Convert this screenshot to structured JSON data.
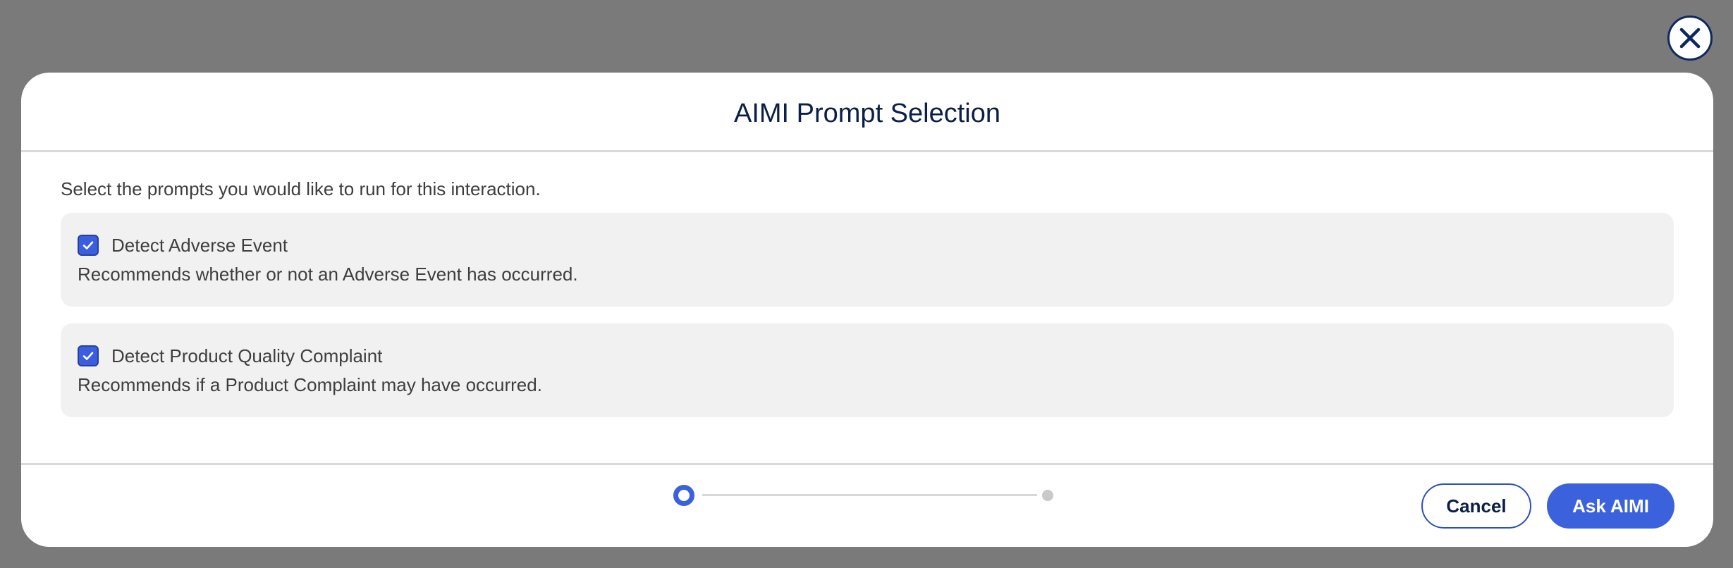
{
  "modal": {
    "title": "AIMI Prompt Selection",
    "instruction": "Select the prompts you would like to run for this interaction.",
    "prompts": [
      {
        "label": "Detect Adverse Event",
        "description": "Recommends whether or not an Adverse Event has occurred.",
        "checked": true
      },
      {
        "label": "Detect Product Quality Complaint",
        "description": "Recommends if a Product Complaint may have occurred.",
        "checked": true
      }
    ],
    "stepper": {
      "current_step": 1,
      "total_steps": 2
    },
    "buttons": {
      "cancel": "Cancel",
      "ask": "Ask AIMI"
    }
  },
  "icons": {
    "close": "close-icon",
    "check": "checkmark-icon"
  },
  "colors": {
    "accent": "#3b62dc",
    "title": "#0b1f47",
    "card_bg": "#f1f1f1",
    "backdrop": "#7a7a7a"
  }
}
